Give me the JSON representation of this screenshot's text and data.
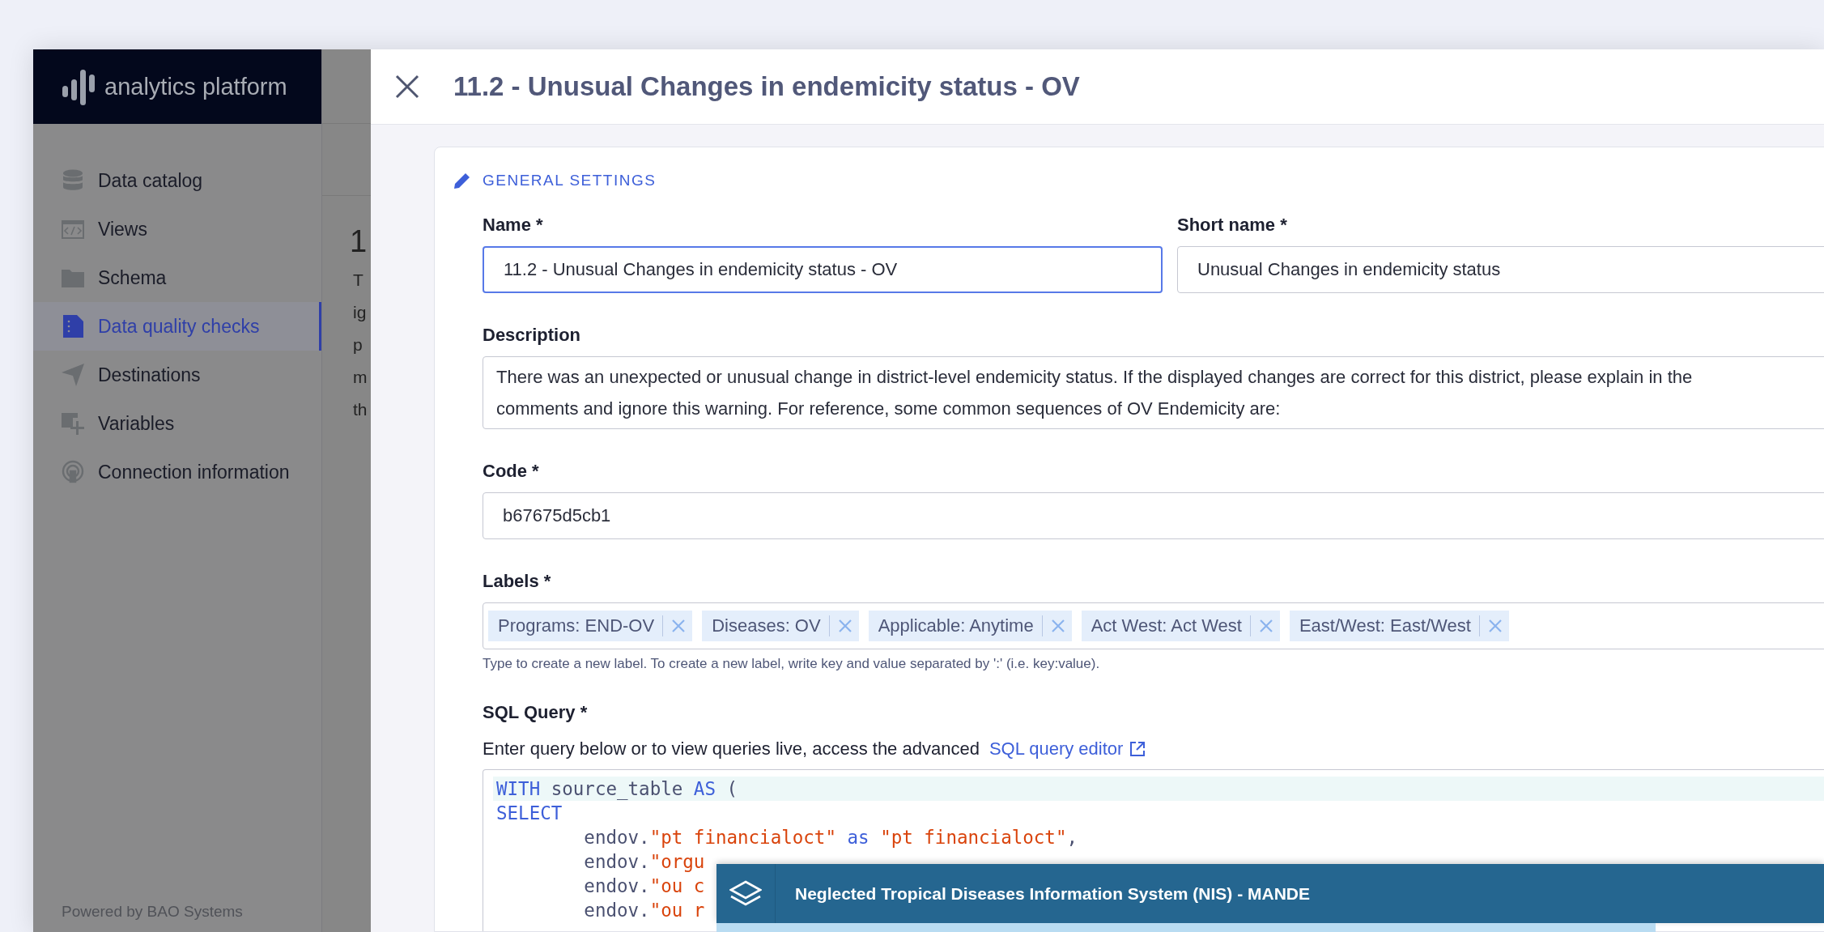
{
  "sidebar": {
    "logo": "analytics platform",
    "items": [
      {
        "label": "Data catalog",
        "kind": "database",
        "selected": false
      },
      {
        "label": "Views",
        "kind": "code",
        "selected": false
      },
      {
        "label": "Schema",
        "kind": "folder",
        "selected": false
      },
      {
        "label": "Data quality checks",
        "kind": "document",
        "selected": true
      },
      {
        "label": "Destinations",
        "kind": "send",
        "selected": false
      },
      {
        "label": "Variables",
        "kind": "add",
        "selected": false
      },
      {
        "label": "Connection information",
        "kind": "broadcast",
        "selected": false
      }
    ],
    "footer": "Powered by BAO Systems"
  },
  "background_page": {
    "title": "1",
    "lines": [
      "T",
      "ig",
      "p",
      "m",
      "th"
    ]
  },
  "panel": {
    "title": "11.2 - Unusual Changes in endemicity status - OV",
    "section": "GENERAL SETTINGS",
    "name": {
      "label": "Name *",
      "value": "11.2 - Unusual Changes in endemicity status - OV",
      "focused": true
    },
    "short_name": {
      "label": "Short name *",
      "value": "Unusual Changes in endemicity status",
      "focused": false
    },
    "description": {
      "label": "Description",
      "value": "There was an unexpected or unusual change in district-level endemicity status. If the displayed changes are correct for this district, please explain in the comments and ignore this warning. For reference, some common sequences of OV Endemicity are:"
    },
    "code": {
      "label": "Code *",
      "value": "b67675d5cb1",
      "focused": false
    },
    "labels": {
      "label": "Labels *",
      "tags": [
        "Programs: END-OV",
        "Diseases: OV",
        "Applicable: Anytime",
        "Act West: Act West",
        "East/West: East/West"
      ],
      "hint": "Type to create a new label. To create a new label, write key and value separated by ':' (i.e. key:value)."
    },
    "sql": {
      "label": "SQL Query *",
      "intro": "Enter query below or to view queries live, access the advanced",
      "link": "SQL query editor",
      "lines": [
        {
          "highlighted": true,
          "tokens": [
            {
              "kind": "keyword",
              "text": "WITH"
            },
            {
              "kind": "plain",
              "text": " source_table "
            },
            {
              "kind": "keyword",
              "text": "AS"
            },
            {
              "kind": "plain",
              "text": " ("
            }
          ]
        },
        {
          "highlighted": false,
          "tokens": [
            {
              "kind": "keyword",
              "text": "SELECT"
            }
          ]
        },
        {
          "highlighted": false,
          "tokens": [
            {
              "kind": "plain",
              "text": "        endov."
            },
            {
              "kind": "string",
              "text": "\"pt financialoct\""
            },
            {
              "kind": "keyword",
              "text": " as "
            },
            {
              "kind": "string",
              "text": "\"pt financialoct\""
            },
            {
              "kind": "plain",
              "text": ","
            }
          ]
        },
        {
          "highlighted": false,
          "tokens": [
            {
              "kind": "plain",
              "text": "        endov."
            },
            {
              "kind": "string",
              "text": "\"orgu"
            }
          ]
        },
        {
          "highlighted": false,
          "tokens": [
            {
              "kind": "plain",
              "text": "        endov."
            },
            {
              "kind": "string",
              "text": "\"ou c"
            }
          ]
        },
        {
          "highlighted": false,
          "tokens": [
            {
              "kind": "plain",
              "text": "        endov."
            },
            {
              "kind": "string",
              "text": "\"ou r"
            }
          ]
        }
      ]
    }
  },
  "banner": {
    "title": "Neglected Tropical Diseases Information System (NIS) - MANDE"
  }
}
